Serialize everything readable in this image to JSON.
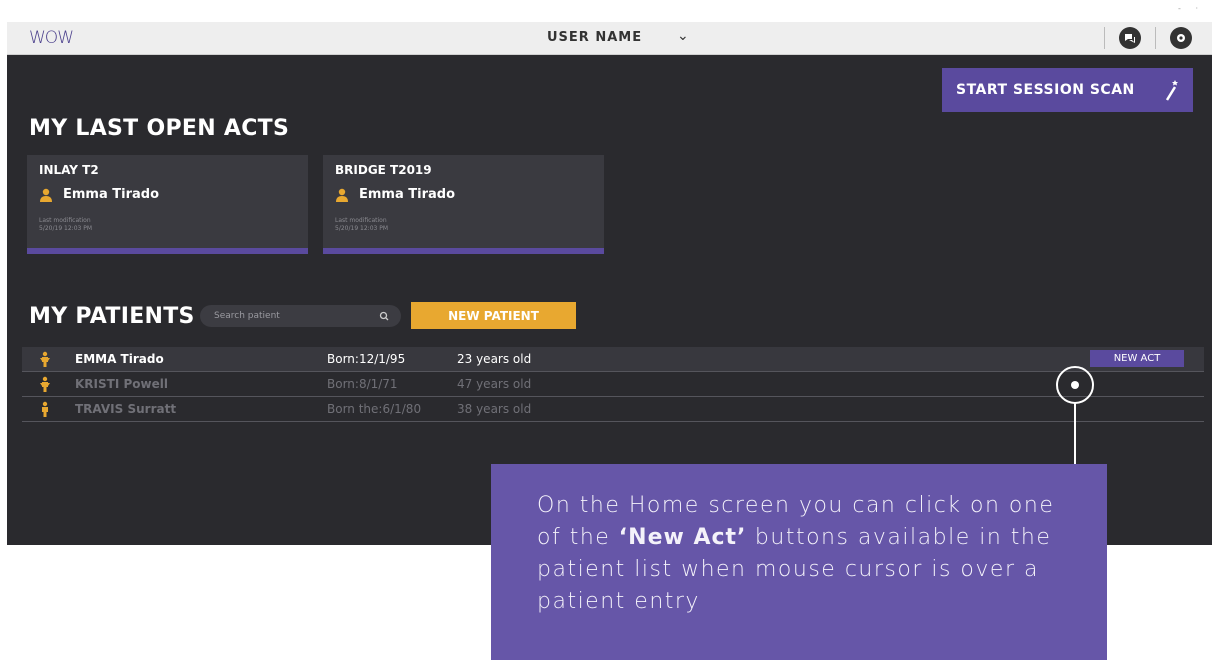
{
  "header": {
    "logo": "WOW",
    "user_name": "USER NAME",
    "dots": "- ·"
  },
  "start_session": {
    "label": "START SESSION SCAN"
  },
  "last_acts": {
    "title": "MY LAST OPEN ACTS",
    "cards": [
      {
        "title": "INLAY T2",
        "patient": "Emma Tirado",
        "mod_label": "Last modification",
        "mod_date": "5/20/19 12:03 PM"
      },
      {
        "title": "BRIDGE T2019",
        "patient": "Emma Tirado",
        "mod_label": "Last modification",
        "mod_date": "5/20/19 12:03 PM"
      }
    ]
  },
  "patients": {
    "title": "MY PATIENTS",
    "search_placeholder": "Search patient",
    "new_patient_label": "NEW PATIENT",
    "new_act_label": "NEW ACT",
    "rows": [
      {
        "name": "EMMA Tirado",
        "born": "Born:12/1/95",
        "age": "23 years old"
      },
      {
        "name": "KRISTI Powell",
        "born": "Born:8/1/71",
        "age": "47 years old"
      },
      {
        "name": "TRAVIS Surratt",
        "born": "Born the:6/1/80",
        "age": "38 years old"
      }
    ]
  },
  "callout": {
    "text_before": "On the Home screen you can click on one of the ",
    "text_bold": "‘New Act’",
    "text_after": " buttons available in the patient list when mouse cursor is over a patient entry"
  },
  "colors": {
    "accent": "#5a4a9e",
    "orange": "#e8a830",
    "bg": "#2a2a2e",
    "callout": "#6656a8"
  }
}
